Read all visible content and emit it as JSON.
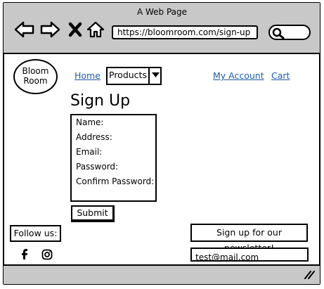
{
  "window": {
    "title": "A Web Page"
  },
  "browser": {
    "url": "https://bloomroom.com/sign-up",
    "icons": [
      "back-arrow-icon",
      "forward-arrow-icon",
      "close-icon",
      "home-icon",
      "search-icon",
      "resize-grip-icon"
    ]
  },
  "site": {
    "logo_text": [
      "Bloom",
      "Room"
    ],
    "nav": {
      "home": "Home",
      "products": "Products",
      "account": "My Account",
      "cart": "Cart"
    }
  },
  "form": {
    "heading": "Sign Up",
    "fields": [
      "Name:",
      "Address:",
      "Email:",
      "Password:",
      "Confirm Password:"
    ],
    "submit_label": "Submit"
  },
  "footer": {
    "follow_label": "Follow us:",
    "social_icons": [
      "facebook-icon",
      "instagram-icon"
    ],
    "newsletter_label": "Sign up for our newsletter!",
    "newsletter_email": "test@mail.com"
  },
  "colors": {
    "chrome": "#c8c8c8",
    "link": "#1f5aa6"
  }
}
